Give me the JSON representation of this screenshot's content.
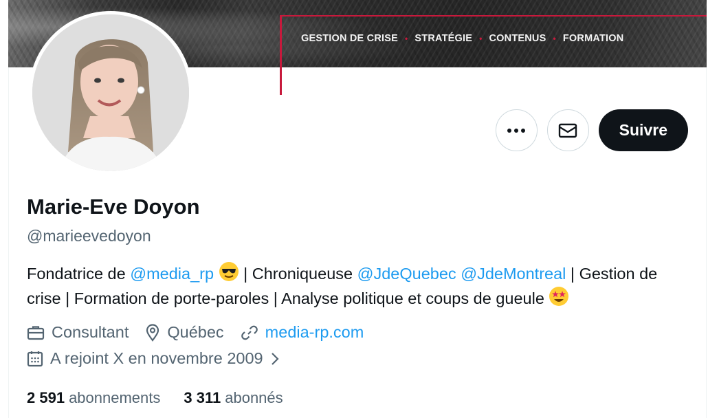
{
  "banner": {
    "nav": [
      "GESTION DE CRISE",
      "STRATÉGIE",
      "CONTENUS",
      "FORMATION"
    ],
    "separator": "•",
    "accent_color": "#c8193c"
  },
  "profile": {
    "name": "Marie-Eve Doyon",
    "handle": "@marieevedoyon",
    "avatar_icon": "profile-photo"
  },
  "actions": {
    "more_icon": "more-dots-icon",
    "message_icon": "envelope-icon",
    "follow_label": "Suivre"
  },
  "bio": {
    "part1": "Fondatrice de ",
    "mention1": "@media_rp",
    "emoji1": "smiling-face-with-sunglasses",
    "part2": " | Chroniqueuse ",
    "mention2": "@JdeQuebec",
    "space": " ",
    "mention3": "@JdeMontreal",
    "part3": " | Gestion de crise | Formation de porte-paroles | Analyse politique et coups de gueule ",
    "emoji2": "star-struck"
  },
  "meta": {
    "category": "Consultant",
    "location": "Québec",
    "website": "media-rp.com",
    "joined": "A rejoint X en novembre 2009"
  },
  "stats": {
    "following_count": "2 591",
    "following_label": "abonnements",
    "followers_count": "3 311",
    "followers_label": "abonnés"
  },
  "colors": {
    "link": "#1d9bf0",
    "secondary_text": "#536471",
    "primary_text": "#0f1419"
  }
}
